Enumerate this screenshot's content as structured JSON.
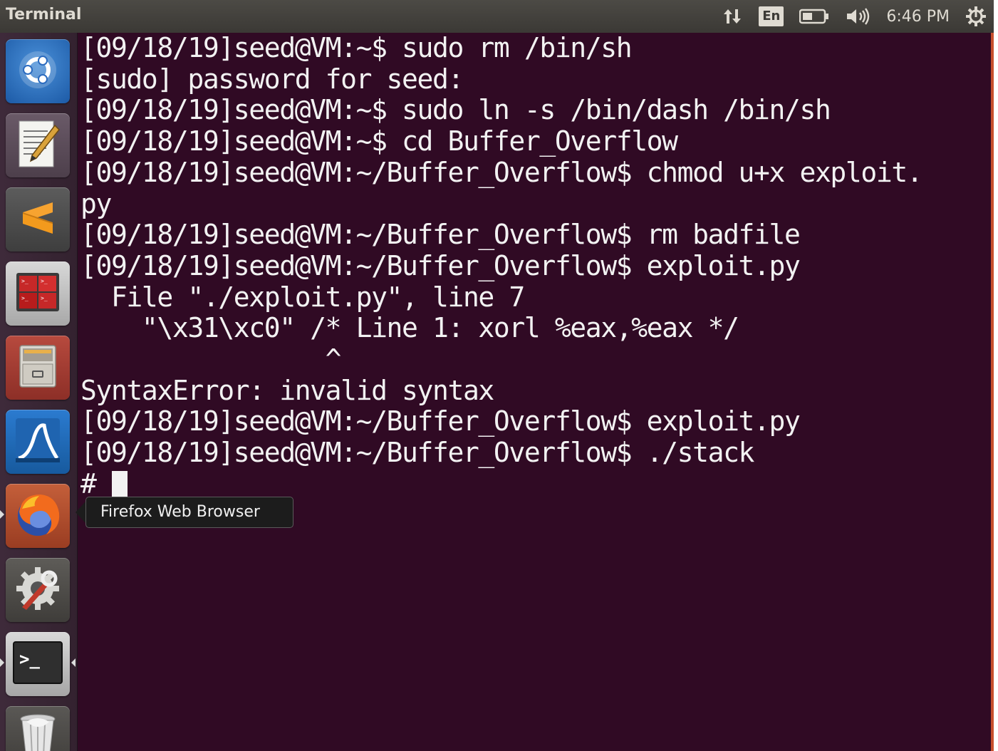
{
  "top_panel": {
    "title": "Terminal",
    "keyboard_layout": "En",
    "clock": "6:46 PM"
  },
  "launcher": {
    "items": [
      {
        "name": "dash-home",
        "icon": "ubuntu-logo-icon"
      },
      {
        "name": "text-editor",
        "icon": "text-editor-icon"
      },
      {
        "name": "sublime-text",
        "icon": "sublime-text-icon"
      },
      {
        "name": "terminator",
        "icon": "terminator-icon"
      },
      {
        "name": "files",
        "icon": "file-cabinet-icon"
      },
      {
        "name": "wireshark",
        "icon": "wireshark-fin-icon"
      },
      {
        "name": "firefox",
        "icon": "firefox-icon"
      },
      {
        "name": "system-settings",
        "icon": "settings-gear-wrench-icon"
      },
      {
        "name": "terminal",
        "icon": "terminal-icon"
      },
      {
        "name": "trash",
        "icon": "trash-icon"
      }
    ]
  },
  "terminal": {
    "lines": [
      "[09/18/19]seed@VM:~$ sudo rm /bin/sh",
      "[sudo] password for seed:",
      "[09/18/19]seed@VM:~$ sudo ln -s /bin/dash /bin/sh",
      "[09/18/19]seed@VM:~$ cd Buffer_Overflow",
      "[09/18/19]seed@VM:~/Buffer_Overflow$ chmod u+x exploit.",
      "py",
      "[09/18/19]seed@VM:~/Buffer_Overflow$ rm badfile",
      "[09/18/19]seed@VM:~/Buffer_Overflow$ exploit.py",
      "  File \"./exploit.py\", line 7",
      "    \"\\x31\\xc0\" /* Line 1: xorl %eax,%eax */",
      "                ^",
      "SyntaxError: invalid syntax",
      "[09/18/19]seed@VM:~/Buffer_Overflow$ exploit.py",
      "[09/18/19]seed@VM:~/Buffer_Overflow$ ./stack",
      "# "
    ]
  },
  "tooltip": {
    "text": "Firefox Web Browser"
  },
  "colors": {
    "terminal_bg": "#300a24",
    "terminal_fg": "#f2f2f2",
    "panel_bg": "#3b3935",
    "accent": "#c7502e"
  }
}
